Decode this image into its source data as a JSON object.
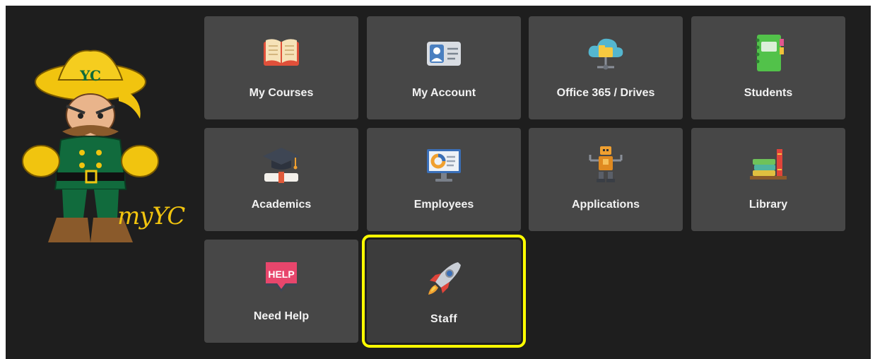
{
  "brand": {
    "logo_text": "myYC",
    "hat_text": "YC"
  },
  "tiles": [
    {
      "label": "My Courses",
      "icon": "open-book-icon"
    },
    {
      "label": "My Account",
      "icon": "id-card-icon"
    },
    {
      "label": "Office 365 / Drives",
      "icon": "cloud-folder-icon"
    },
    {
      "label": "Students",
      "icon": "notebook-icon"
    },
    {
      "label": "Academics",
      "icon": "graduation-cap-icon"
    },
    {
      "label": "Employees",
      "icon": "monitor-icon"
    },
    {
      "label": "Applications",
      "icon": "robot-icon"
    },
    {
      "label": "Library",
      "icon": "books-icon"
    },
    {
      "label": "Need Help",
      "icon": "help-sign-icon",
      "badge": "HELP"
    },
    {
      "label": "Staff",
      "icon": "rocket-icon"
    }
  ],
  "colors": {
    "background": "#1e1e1e",
    "tile": "#474747",
    "highlight": "#ffff00"
  }
}
